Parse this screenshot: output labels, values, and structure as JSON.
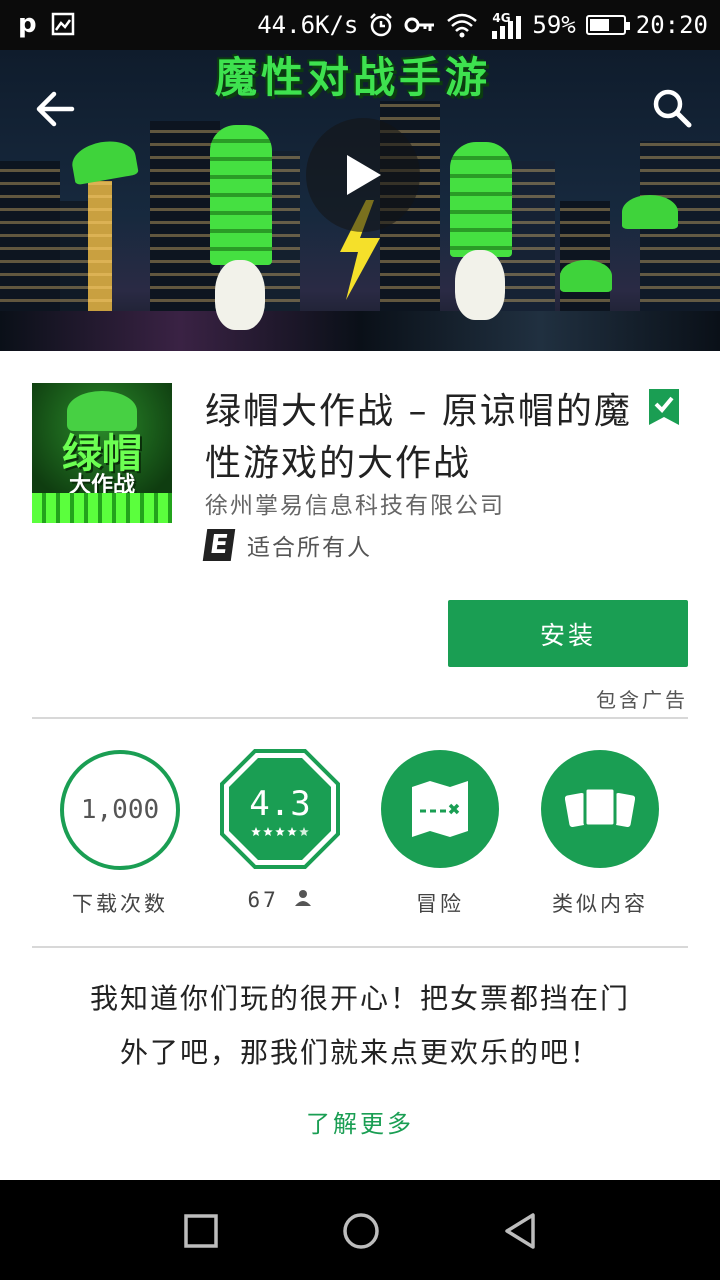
{
  "status_bar": {
    "left_letter": "p",
    "speed": "44.6K/s",
    "network": "4G",
    "battery": "59%",
    "battery_level": 0.59,
    "time": "20:20"
  },
  "hero": {
    "banner_title": "魔性对战手游",
    "back_icon": "arrow-back-icon",
    "search_icon": "search-icon",
    "play_icon": "play-icon"
  },
  "app": {
    "icon_text_1": "绿帽",
    "icon_text_2": "大作战",
    "title": "绿帽大作战 – 原谅帽的魔性游戏的大作战",
    "developer": "徐州掌易信息科技有限公司",
    "content_rating_badge": "E",
    "content_rating": "适合所有人",
    "install_label": "安装",
    "contains_ads": "包含广告"
  },
  "stats": {
    "downloads_value": "1,000",
    "downloads_label": "下载次数",
    "rating_value": "4.3",
    "rating_stars": 4.3,
    "rating_count": "67",
    "category_label": "冒险",
    "similar_label": "类似内容"
  },
  "description": {
    "line1": "我知道你们玩的很开心！把女票都挡在门",
    "line2": "外了吧，那我们就来点更欢乐的吧！",
    "learn_more": "了解更多"
  },
  "colors": {
    "accent": "#1a9e53",
    "status_bar": "#0b0b0b",
    "nav_bar": "#000000"
  }
}
